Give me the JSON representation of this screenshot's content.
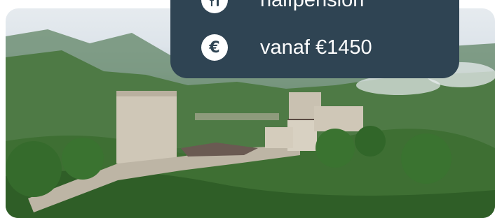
{
  "offer": {
    "board_type": "halfpension",
    "board_icon": "cutlery-icon",
    "price_text": "vanaf €1450",
    "price_icon": "euro-icon",
    "price_icon_glyph": "€"
  },
  "colors": {
    "panel_background": "#2f4453",
    "panel_text": "#ffffff"
  }
}
